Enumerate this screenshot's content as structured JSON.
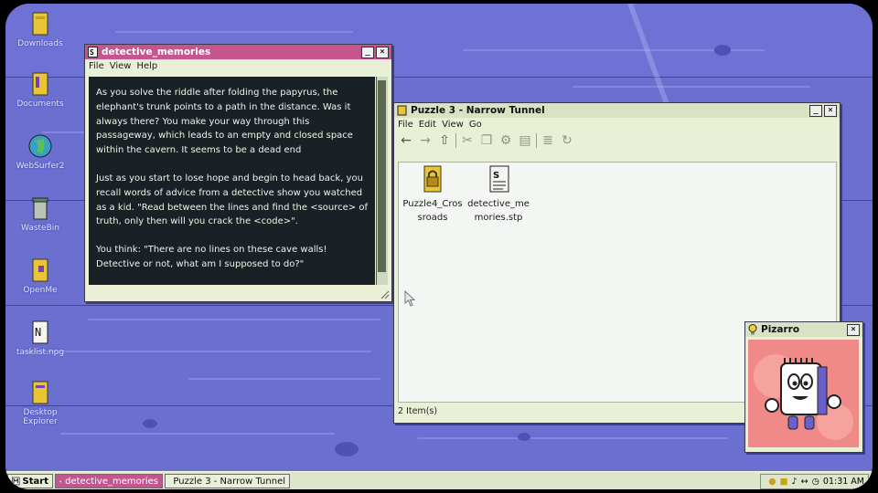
{
  "desktop": {
    "icons": [
      {
        "name": "downloads",
        "label": "Downloads"
      },
      {
        "name": "documents",
        "label": "Documents"
      },
      {
        "name": "websurfer",
        "label": "WebSurfer2"
      },
      {
        "name": "wastebin",
        "label": "WasteBin"
      },
      {
        "name": "openme",
        "label": "OpenMe"
      },
      {
        "name": "tasklist",
        "label": "tasklist.npg"
      },
      {
        "name": "desktop-explorer",
        "label": "Desktop Explorer"
      }
    ]
  },
  "memories_window": {
    "title": "detective_memories",
    "menu": [
      "File",
      "View",
      "Help"
    ],
    "paragraphs": [
      "As you solve the riddle after folding the papyrus, the elephant's trunk points to a path in the distance. Was it always there? You make your way through this passageway, which leads to an empty and closed space within the cavern. It seems to be a dead end",
      "Just as you start to lose hope and begin to head back, you recall words of advice from a detective show you watched as a kid. \"Read between the lines and find the <source> of truth, only then will you crack the <code>\".",
      "You think: \"There are no lines on these cave walls! Detective or not, what am I supposed to do?\""
    ]
  },
  "puzzle_window": {
    "title": "Puzzle 3 - Narrow Tunnel",
    "menu": [
      "File",
      "Edit",
      "View",
      "Go"
    ],
    "files": [
      {
        "label": "Puzzle4_Crossroads",
        "icon": "locked-folder-icon"
      },
      {
        "label": "detective_memories.stp",
        "icon": "document-icon"
      }
    ],
    "status": "2 Item(s)"
  },
  "pizarro_window": {
    "title": "Pizarro"
  },
  "taskbar": {
    "start": "Start",
    "tasks": [
      "detective_memories",
      "Puzzle 3 - Narrow Tunnel"
    ],
    "clock": "01:31 AM"
  },
  "colors": {
    "desktop": "#6a6fd0",
    "active_title": "#c4558f",
    "window_bg": "#e9f0d6",
    "terminal_bg": "#1a2126"
  }
}
